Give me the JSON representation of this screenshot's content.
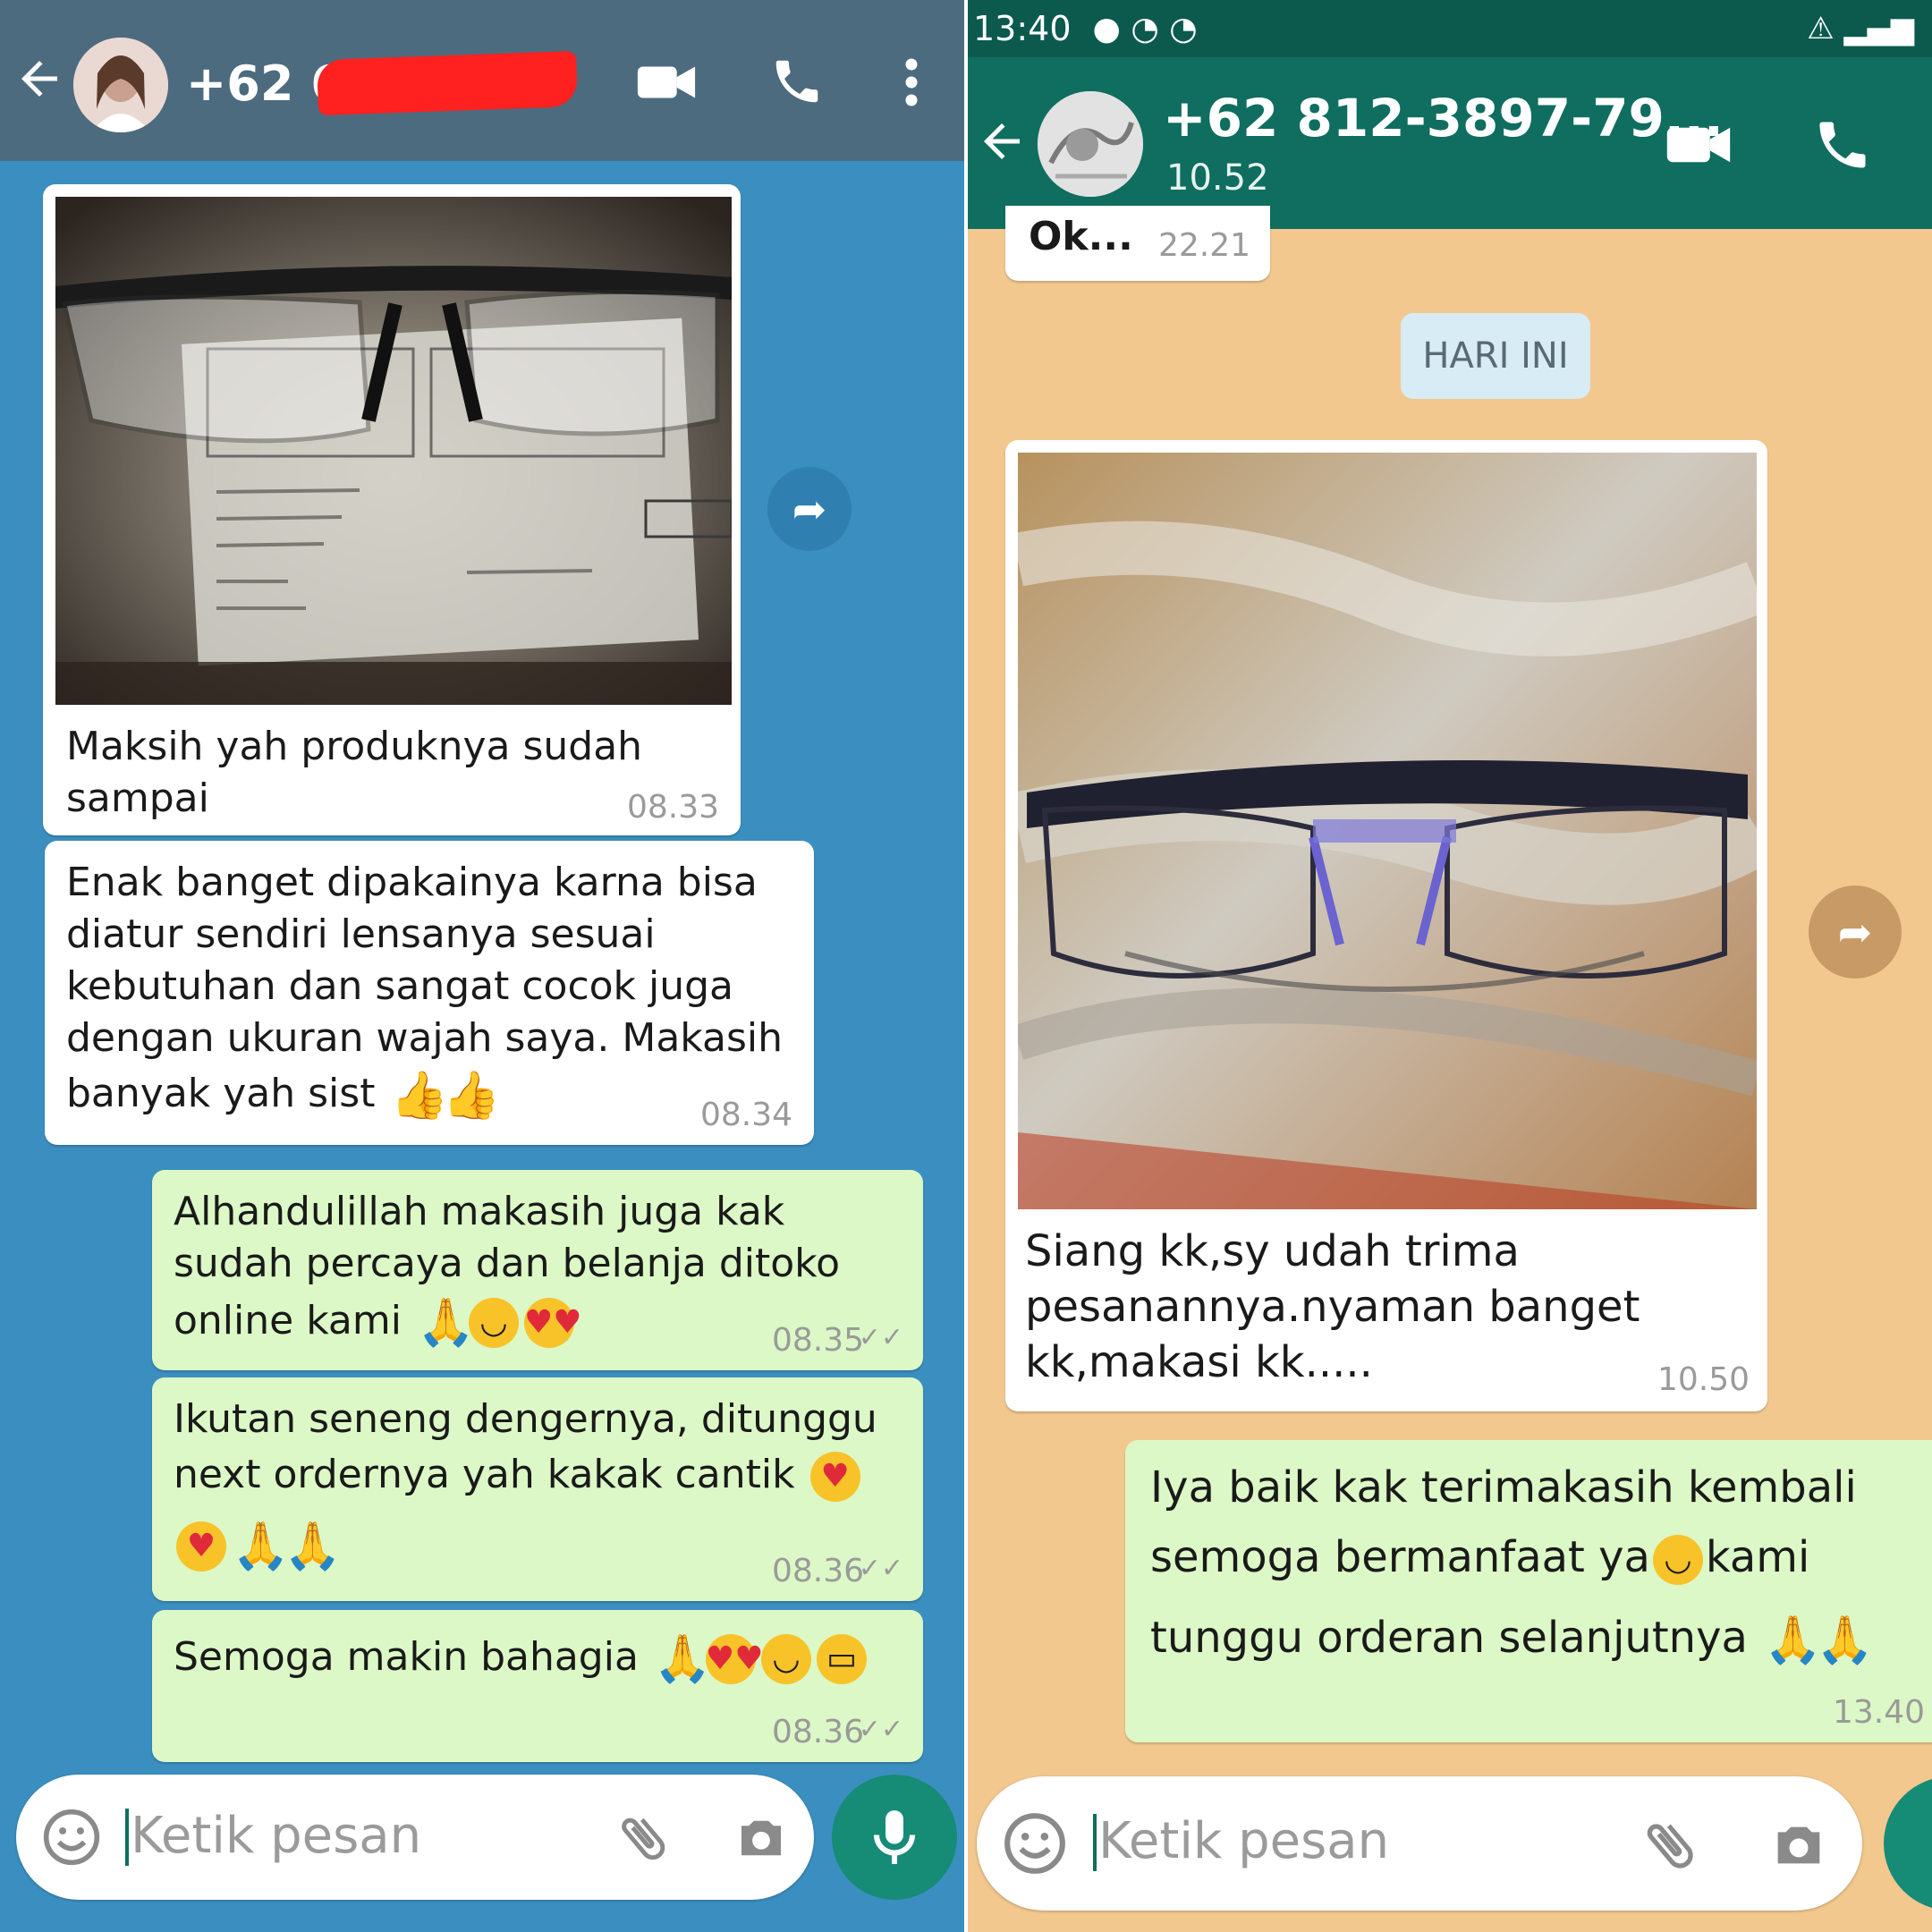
{
  "left": {
    "header": {
      "contact_prefix": "+62 6",
      "icons": [
        "back-arrow-icon",
        "video-call-icon",
        "phone-icon",
        "more-vert-icon"
      ]
    },
    "messages": [
      {
        "type": "image",
        "caption_line1": "Maksih yah produknya sudah",
        "caption_line2": "sampai",
        "time": "08.33",
        "direction": "incoming"
      },
      {
        "line1": "Enak banget dipakainya karna bisa",
        "line2": "diatur sendiri lensanya sesuai",
        "line3": "kebutuhan dan sangat cocok juga",
        "line4": "dengan ukuran wajah saya. Makasih",
        "line5": "banyak yah sist",
        "time": "08.34",
        "direction": "incoming"
      },
      {
        "line1": "Alhandulillah makasih juga kak",
        "line2": "sudah percaya dan belanja ditoko",
        "line3": "online kami",
        "time": "08.35",
        "direction": "outgoing"
      },
      {
        "line1": "Ikutan seneng dengernya, ditunggu",
        "line2": "next ordernya yah kakak cantik",
        "time": "08.36",
        "direction": "outgoing"
      },
      {
        "line1": "Semoga makin bahagia",
        "time": "08.36",
        "direction": "outgoing"
      }
    ],
    "input": {
      "placeholder": "Ketik pesan"
    }
  },
  "right": {
    "statusbar": {
      "time": "13:40"
    },
    "header": {
      "contact": "+62 812-3897-79...",
      "status": "10.52"
    },
    "prev_message": {
      "text": "Ok...",
      "time": "22.21"
    },
    "date_chip": "HARI INI",
    "messages": [
      {
        "type": "image",
        "line1": "Siang kk,sy udah trima",
        "line2": "pesanannya.nyaman banget",
        "line3": "kk,makasi kk.....",
        "time": "10.50",
        "direction": "incoming"
      },
      {
        "line1": "Iya baik kak terimakasih kembali",
        "line2a": "semoga bermanfaat ya",
        "line2b": "kami",
        "line3": "tunggu orderan selanjutnya",
        "time": "13.40",
        "direction": "outgoing"
      }
    ],
    "input": {
      "placeholder": "Ketik pesan"
    }
  },
  "colors": {
    "left_chat_bg": "#3b8fc0",
    "right_chat_bg": "#f2c88f",
    "outgoing_bubble": "#dcf8c6",
    "incoming_bubble": "#ffffff",
    "whatsapp_green": "#0f6e5f"
  }
}
